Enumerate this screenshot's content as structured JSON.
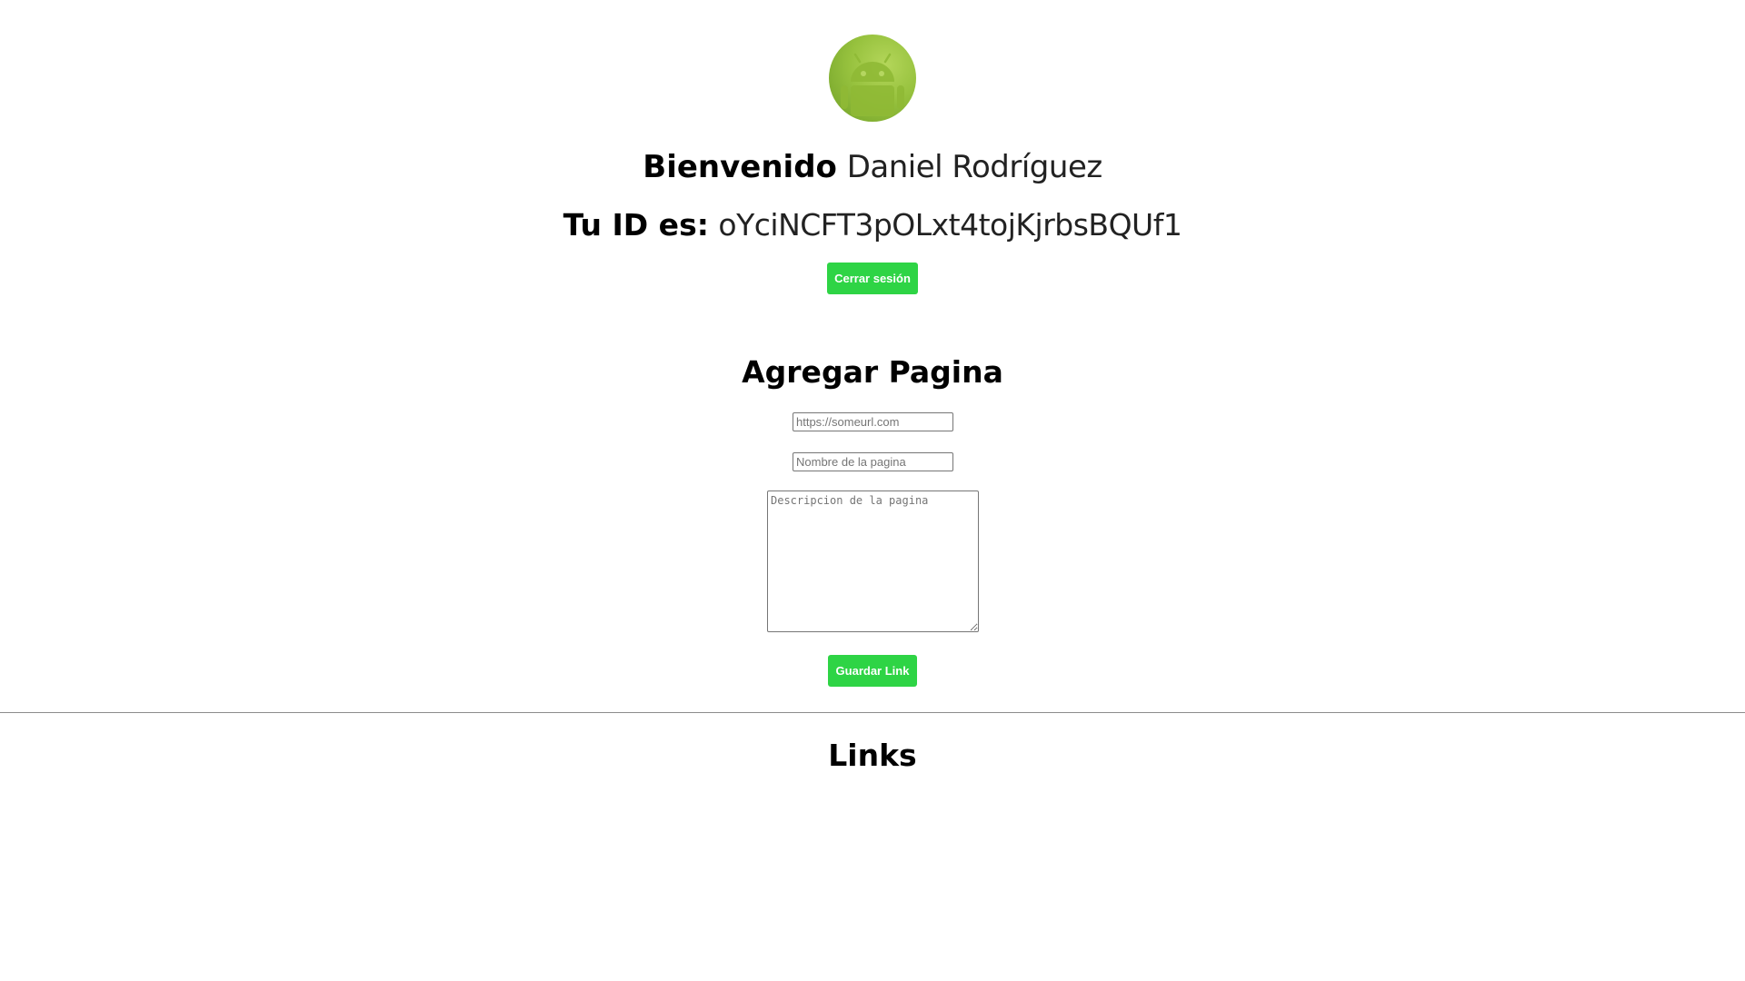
{
  "profile": {
    "avatar_icon": "android-robot-icon",
    "welcome_label": "Bienvenido",
    "user_name": "Daniel Rodríguez",
    "id_label": "Tu ID es:",
    "user_id": "oYciNCFT3pOLxt4tojKjrbsBQUf1",
    "logout_label": "Cerrar sesión"
  },
  "add_page": {
    "title": "Agregar Pagina",
    "url_placeholder": "https://someurl.com",
    "name_placeholder": "Nombre de la pagina",
    "description_placeholder": "Descripcion de la pagina",
    "save_label": "Guardar Link"
  },
  "links": {
    "title": "Links"
  },
  "colors": {
    "accent": "#2ed445",
    "avatar": "#97c23e"
  }
}
